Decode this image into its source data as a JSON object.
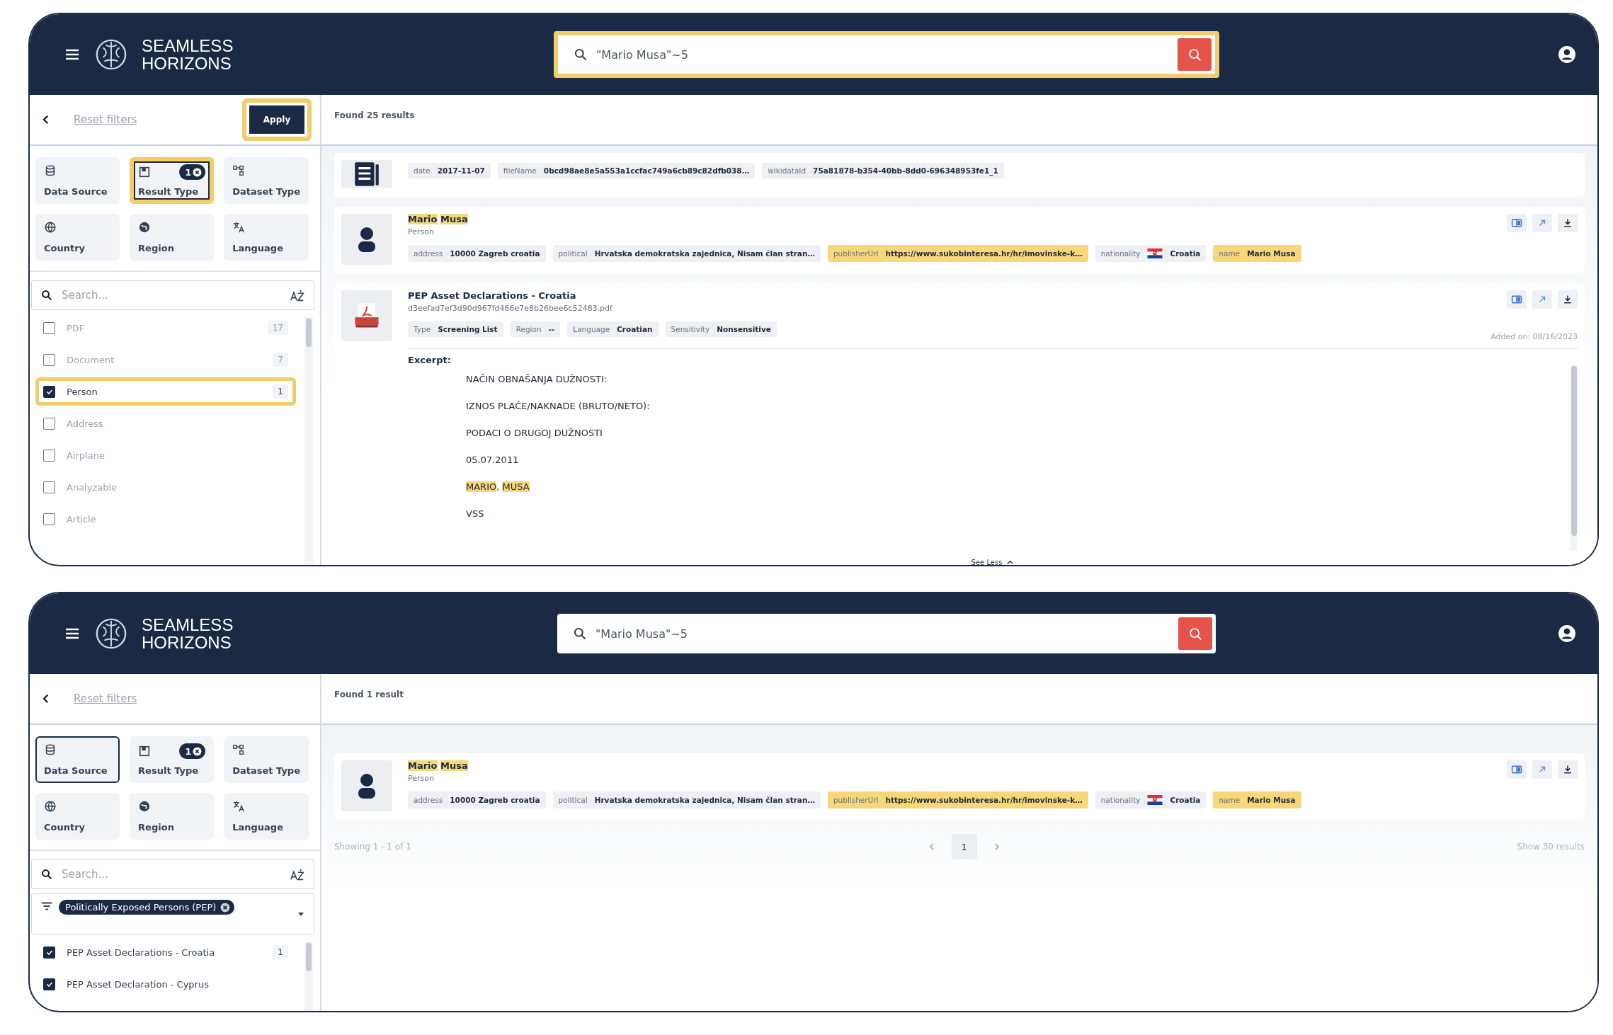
{
  "screens": [
    {
      "header": {
        "brand": [
          "SEAMLESS",
          "HORIZONS"
        ],
        "search": {
          "value": "\"Mario Musa\"~5",
          "highlighted": true
        }
      },
      "sidebar": {
        "reset": "Reset filters",
        "apply": {
          "label": "Apply",
          "highlighted": true
        },
        "tiles": [
          {
            "label": "Data Source",
            "selected": false,
            "highlighted": false
          },
          {
            "label": "Result Type",
            "badge": "1",
            "selected": true,
            "highlighted": true
          },
          {
            "label": "Dataset Type",
            "selected": false,
            "highlighted": false
          },
          {
            "label": "Country",
            "selected": false,
            "highlighted": false
          },
          {
            "label": "Region",
            "selected": false,
            "highlighted": false
          },
          {
            "label": "Language",
            "selected": false,
            "highlighted": false
          }
        ],
        "search": {
          "placeholder": "Search..."
        },
        "options": [
          {
            "label": "PDF",
            "count": "17",
            "checked": false,
            "highlighted": false
          },
          {
            "label": "Document",
            "count": "7",
            "checked": false,
            "highlighted": false
          },
          {
            "label": "Person",
            "count": "1",
            "checked": true,
            "highlighted": true
          },
          {
            "label": "Address",
            "checked": false,
            "highlighted": false
          },
          {
            "label": "Airplane",
            "checked": false,
            "highlighted": false
          },
          {
            "label": "Analyzable",
            "checked": false,
            "highlighted": false
          },
          {
            "label": "Article",
            "checked": false,
            "highlighted": false
          }
        ]
      },
      "results": {
        "found": "Found 25 results",
        "cards": [
          {
            "kind": "document",
            "chips": [
              {
                "key": "date",
                "value": "2017-11-07",
                "kind": "plain",
                "highlighted": false
              },
              {
                "key": "fileName",
                "value": "0bcd98ae8e5a553a1ccfac749a6cb89c82dfb038…",
                "kind": "plain",
                "highlighted": false
              },
              {
                "key": "wikidataId",
                "value": "75a81878-b354-40bb-8dd0-696348953fe1_1",
                "kind": "plain",
                "highlighted": false
              }
            ]
          },
          {
            "kind": "person",
            "actions": true,
            "title": [
              {
                "text": "Mario",
                "highlighted": true
              },
              {
                "text": "Musa",
                "highlighted": true
              }
            ],
            "subtitle": "Person",
            "chips": [
              {
                "key": "address",
                "value": "10000 Zagreb croatia",
                "kind": "plain",
                "highlighted": false
              },
              {
                "key": "political",
                "value": "Hrvatska demokratska zajednica, Nisam član stran…",
                "kind": "plain",
                "highlighted": false
              },
              {
                "key": "publisherUrl",
                "value": "https://www.sukobinteresa.hr/hr/imovinske-k…",
                "kind": "plain",
                "highlighted": true
              },
              {
                "key": "nationality",
                "value": "Croatia",
                "kind": "flag",
                "highlighted": false
              },
              {
                "key": "name",
                "value": "Mario Musa",
                "kind": "plain",
                "highlighted": true
              }
            ]
          },
          {
            "kind": "pdf",
            "actions": true,
            "title": [
              {
                "text": "PEP Asset Declarations - Croatia",
                "highlighted": false
              }
            ],
            "subtitle": "d3eefad7ef3d90d967fd466e7e8b26bee6c52483.pdf",
            "added": "Added on: 08/16/2023",
            "chips": [
              {
                "key": "Type",
                "value": "Screening List",
                "kind": "plain",
                "highlighted": false
              },
              {
                "key": "Region",
                "value": "--",
                "kind": "plain",
                "highlighted": false
              },
              {
                "key": "Language",
                "value": "Croatian",
                "kind": "plain",
                "highlighted": false
              },
              {
                "key": "Sensitivity",
                "value": "Nonsensitive",
                "kind": "plain",
                "highlighted": false
              }
            ],
            "excerpt": {
              "label": "Excerpt:",
              "toggle": "See Less",
              "lines": [
                [
                  {
                    "text": "NAČIN OBNAŠANJA DUŽNOSTI:",
                    "highlighted": false
                  }
                ],
                [
                  {
                    "text": "IZNOS PLAĆE/NAKNADE (BRUTO/NETO):",
                    "highlighted": false
                  }
                ],
                [
                  {
                    "text": "PODACI O DRUGOJ DUŽNOSTI",
                    "highlighted": false
                  }
                ],
                [
                  {
                    "text": "05.07.2011",
                    "highlighted": false
                  }
                ],
                [
                  {
                    "text": "MARIO",
                    "highlighted": true
                  },
                  {
                    "text": ", ",
                    "highlighted": false
                  },
                  {
                    "text": "MUSA",
                    "highlighted": true
                  }
                ],
                [
                  {
                    "text": "VSS",
                    "highlighted": false
                  }
                ]
              ]
            }
          }
        ]
      }
    },
    {
      "header": {
        "brand": [
          "SEAMLESS",
          "HORIZONS"
        ],
        "search": {
          "value": "\"Mario Musa\"~5",
          "highlighted": false
        }
      },
      "sidebar": {
        "reset": "Reset filters",
        "tiles": [
          {
            "label": "Data Source",
            "selected": true,
            "highlighted": false
          },
          {
            "label": "Result Type",
            "badge": "1",
            "selected": false,
            "highlighted": false
          },
          {
            "label": "Dataset Type",
            "selected": false,
            "highlighted": false
          },
          {
            "label": "Country",
            "selected": false,
            "highlighted": false
          },
          {
            "label": "Region",
            "selected": false,
            "highlighted": false
          },
          {
            "label": "Language",
            "selected": false,
            "highlighted": false
          }
        ],
        "search": {
          "placeholder": "Search..."
        },
        "filter_chips": [
          {
            "label": "Politically Exposed Persons (PEP)"
          }
        ],
        "options": [
          {
            "label": "PEP Asset Declarations - Croatia",
            "count": "1",
            "checked": true,
            "highlighted": false
          },
          {
            "label": "PEP Asset Declaration - Cyprus",
            "checked": true,
            "highlighted": false
          }
        ]
      },
      "results": {
        "found": "Found 1 result",
        "cards": [
          {
            "kind": "person",
            "actions": true,
            "title": [
              {
                "text": "Mario",
                "highlighted": true
              },
              {
                "text": "Musa",
                "highlighted": true
              }
            ],
            "subtitle": "Person",
            "chips": [
              {
                "key": "address",
                "value": "10000 Zagreb croatia",
                "kind": "plain",
                "highlighted": false
              },
              {
                "key": "political",
                "value": "Hrvatska demokratska zajednica, Nisam član stran…",
                "kind": "plain",
                "highlighted": false
              },
              {
                "key": "publisherUrl",
                "value": "https://www.sukobinteresa.hr/hr/imovinske-k…",
                "kind": "plain",
                "highlighted": true
              },
              {
                "key": "nationality",
                "value": "Croatia",
                "kind": "flag",
                "highlighted": false
              },
              {
                "key": "name",
                "value": "Mario Musa",
                "kind": "plain",
                "highlighted": true
              }
            ]
          }
        ],
        "footer": {
          "showing": "Showing 1 - 1 of 1",
          "pages": [
            {
              "label": "1",
              "selected": true
            }
          ],
          "show": "Show 30 results"
        }
      }
    }
  ]
}
